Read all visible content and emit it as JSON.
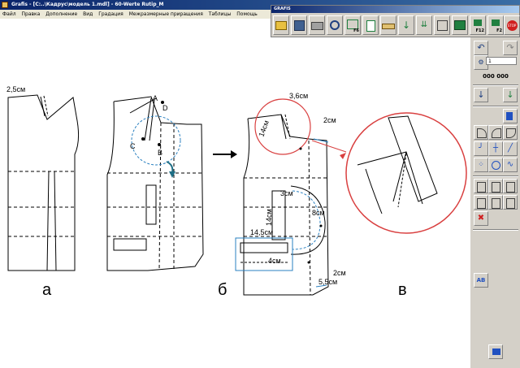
{
  "window": {
    "title": "Grafis - [C:..\\Кадрус\\модель 1.mdl] - 60-Werte Rutip_M"
  },
  "menu": [
    "Файл",
    "Правка",
    "Дополнение",
    "Вид",
    "Градация",
    "Межразмерные приращения",
    "Таблицы",
    "Помощь"
  ],
  "toolbar": {
    "title": "GRAFIS",
    "buttons": [
      {
        "icon": "open-folder-icon"
      },
      {
        "icon": "save-icon"
      },
      {
        "icon": "print-icon"
      },
      {
        "icon": "magnify-icon"
      },
      {
        "icon": "fit-view-icon",
        "label": "F6"
      },
      {
        "icon": "page-icon"
      },
      {
        "icon": "measure-icon"
      },
      {
        "icon": "arrow-down-icon"
      },
      {
        "icon": "dimension-icon"
      },
      {
        "icon": "grading-icon"
      },
      {
        "icon": "table-icon"
      },
      {
        "icon": "f12-icon",
        "label": "F12"
      },
      {
        "icon": "f2-icon",
        "label": "F2"
      },
      {
        "icon": "stop-icon",
        "label": "STOP"
      }
    ]
  },
  "side_panel": {
    "counter": "000 000",
    "field_value": "1"
  },
  "drawing": {
    "labels": {
      "a": "а",
      "b": "б",
      "v": "в"
    },
    "points": [
      "A",
      "D",
      "C",
      "B"
    ],
    "dimensions": {
      "shoulder_left": "2,5см",
      "shoulder_mid": "3,6см",
      "neck_14": "14см",
      "top_2": "2см",
      "side_14": "14см",
      "dart_3": "3см",
      "curve_8": "8см",
      "pocket_14_5": "14,5см",
      "pocket_4": "4см",
      "hem_2": "2см",
      "hem_5_5": "5,5см"
    }
  },
  "colors": {
    "accent_red": "#d94040",
    "dim_blue": "#2a80c0",
    "teal_arrow": "#1f6f86"
  }
}
